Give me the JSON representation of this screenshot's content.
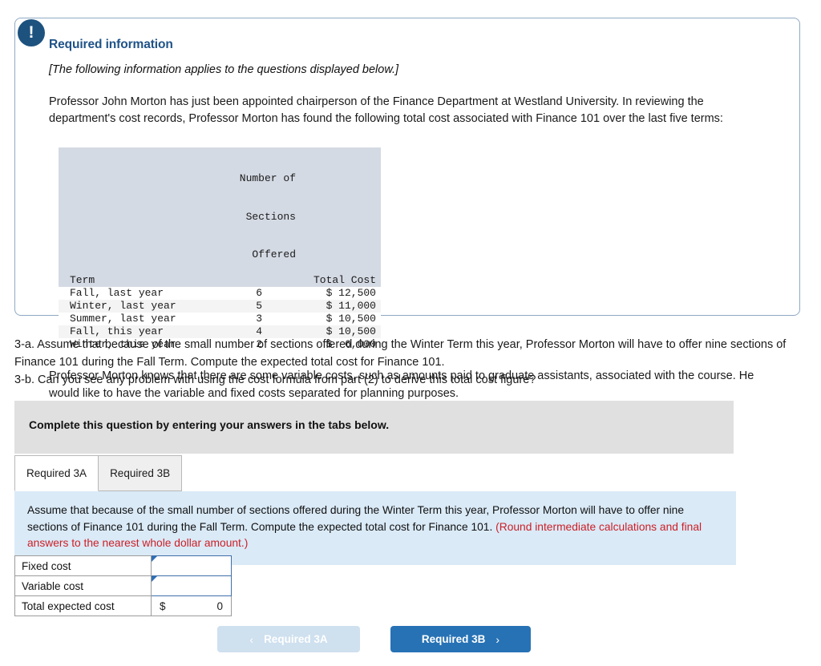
{
  "required_info": {
    "badge_icon": "exclamation-icon",
    "heading": "Required information",
    "subtitle": "[The following information applies to the questions displayed below.]",
    "paragraph_top": "Professor John Morton has just been appointed chairperson of the Finance Department at Westland University. In reviewing the department's cost records, Professor Morton has found the following total cost associated with Finance 101 over the last five terms:",
    "paragraph_bottom": "Professor Morton knows that there are some variable costs, such as amounts paid to graduate assistants, associated with the course. He would like to have the variable and fixed costs separated for planning purposes.",
    "table": {
      "headers": {
        "term": "Term",
        "sections_line1": "Number of",
        "sections_line2": "Sections",
        "sections_line3": "Offered",
        "total_cost": "Total Cost"
      },
      "rows": [
        {
          "term": "Fall, last year",
          "sections": "6",
          "cost": "$ 12,500"
        },
        {
          "term": "Winter, last year",
          "sections": "5",
          "cost": "$ 11,000"
        },
        {
          "term": "Summer, last year",
          "sections": "3",
          "cost": "$ 10,500"
        },
        {
          "term": "Fall, this year",
          "sections": "4",
          "cost": "$ 10,500"
        },
        {
          "term": "Winter, this year",
          "sections": "2",
          "cost": "$  6,000"
        }
      ]
    }
  },
  "question": {
    "line_3a": "3-a. Assume that because of the small number of sections offered during the Winter Term this year, Professor Morton will have to offer nine sections of Finance 101 during the Fall Term. Compute the expected total cost for Finance 101.",
    "line_3b": "3-b. Can you see any problem with using the cost formula from part (2) to derive this total cost figure?"
  },
  "complete_bar": {
    "text": "Complete this question by entering your answers in the tabs below."
  },
  "tabs": [
    {
      "label": "Required 3A",
      "active": true
    },
    {
      "label": "Required 3B",
      "active": false
    }
  ],
  "blue_panel": {
    "text_main": "Assume that because of the small number of sections offered during the Winter Term this year, Professor Morton will have to offer nine sections of Finance 101 during the Fall Term. Compute the expected total cost for Finance 101. ",
    "text_red": "(Round intermediate calculations and final answers to the nearest whole dollar amount.)"
  },
  "answer_table": {
    "rows": [
      {
        "label": "Fixed cost",
        "value": ""
      },
      {
        "label": "Variable cost",
        "value": ""
      }
    ],
    "total": {
      "label": "Total expected cost",
      "currency": "$",
      "amount": "0"
    }
  },
  "navigation": {
    "prev_label": "Required 3A",
    "prev_chevron": "‹",
    "next_label": "Required 3B",
    "next_chevron": "›"
  },
  "colors": {
    "panel_border": "#8fa9c4",
    "badge": "#1d527f",
    "heading": "#1e5288",
    "table_header_bg": "#d4dae4",
    "gray_bar": "#e0e0e0",
    "blue_panel_bg": "#daeaf7",
    "red_text": "#cc2027",
    "next_button": "#2772b5",
    "prev_button_disabled": "#cfe0ef",
    "input_border": "#3f6fa8"
  }
}
